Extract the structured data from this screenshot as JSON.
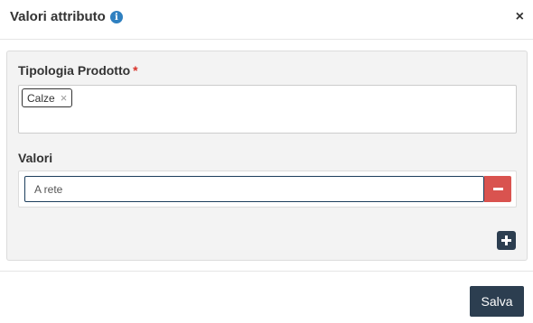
{
  "modal": {
    "title": "Valori attributo",
    "info_icon": "info-icon",
    "close_icon": "close-icon",
    "close_label": "×"
  },
  "form": {
    "tipologia": {
      "label": "Tipologia Prodotto",
      "required_mark": "*",
      "tags": [
        {
          "label": "Calze",
          "remove": "×"
        }
      ]
    },
    "valori": {
      "label": "Valori",
      "items": [
        {
          "value": "A rete",
          "remove_icon": "minus-icon"
        }
      ],
      "add_icon": "plus-icon"
    }
  },
  "footer": {
    "save_label": "Salva"
  },
  "colors": {
    "primary": "#2c3e50",
    "danger": "#d9534f",
    "required": "#d9332a",
    "info": "#2f80c0"
  }
}
